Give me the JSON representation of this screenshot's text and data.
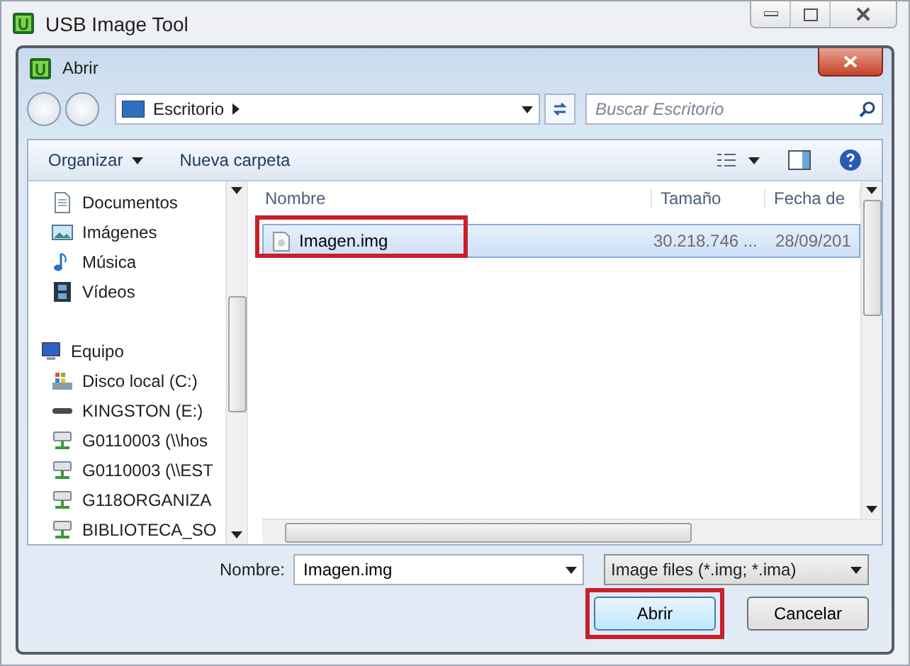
{
  "app_window": {
    "title": "USB Image Tool"
  },
  "dialog": {
    "title": "Abrir",
    "address": {
      "location": "Escritorio"
    },
    "search": {
      "placeholder": "Buscar Escritorio"
    },
    "toolbar": {
      "organize": "Organizar",
      "new_folder": "Nueva carpeta"
    },
    "sidebar": {
      "items": [
        {
          "label": "Documentos",
          "kind": "document"
        },
        {
          "label": "Imágenes",
          "kind": "images"
        },
        {
          "label": "Música",
          "kind": "music"
        },
        {
          "label": "Vídeos",
          "kind": "video"
        },
        {
          "label": "Equipo",
          "kind": "computer",
          "children": [
            {
              "label": "Disco local (C:)",
              "kind": "system-drive"
            },
            {
              "label": "KINGSTON (E:)",
              "kind": "usb-drive"
            },
            {
              "label": "G0110003 (\\\\hos",
              "kind": "network-drive"
            },
            {
              "label": "G0110003 (\\\\EST",
              "kind": "network-drive"
            },
            {
              "label": "G118ORGANIZA",
              "kind": "network-drive"
            },
            {
              "label": "BIBLIOTECA_SO",
              "kind": "network-drive"
            }
          ]
        }
      ]
    },
    "file_list": {
      "columns": [
        "Nombre",
        "Tamaño",
        "Fecha de"
      ],
      "rows": [
        {
          "name": "Imagen.img",
          "size": "30.218.746 ...",
          "date": "28/09/201",
          "selected": true,
          "highlighted": true
        }
      ]
    },
    "filename": {
      "label": "Nombre:",
      "value": "Imagen.img"
    },
    "filter": {
      "value": "Image files (*.img; *.ima)"
    },
    "buttons": [
      {
        "label": "Abrir",
        "highlighted": true
      },
      {
        "label": "Cancelar",
        "highlighted": false
      }
    ]
  }
}
